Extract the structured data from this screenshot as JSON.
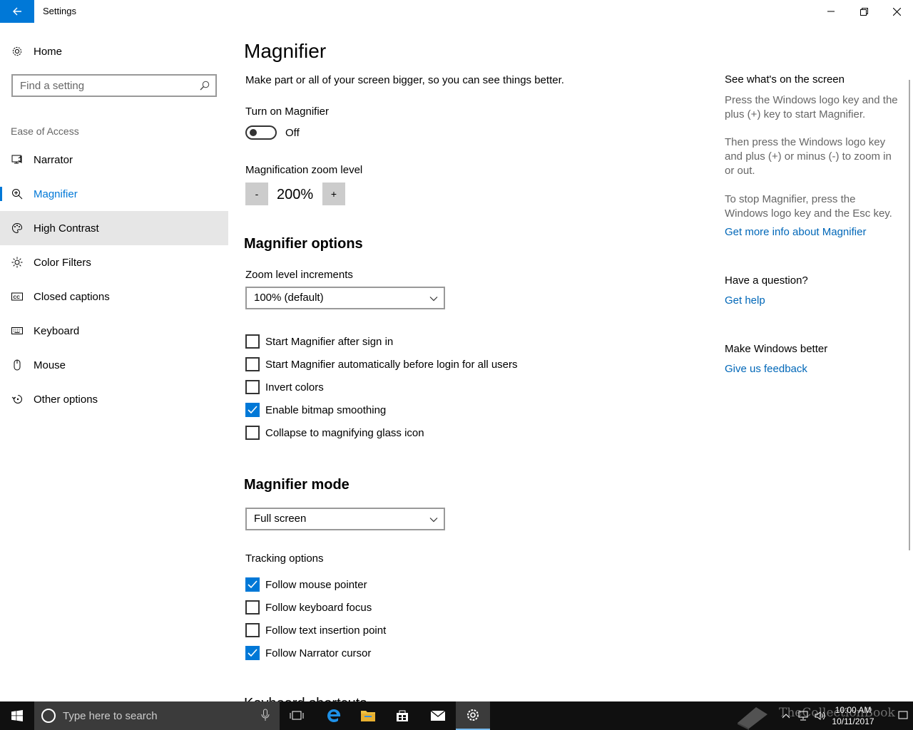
{
  "window": {
    "title": "Settings"
  },
  "sidebar": {
    "home_label": "Home",
    "search_placeholder": "Find a setting",
    "section_label": "Ease of Access",
    "items": [
      {
        "label": "Narrator",
        "icon": "narrator-icon"
      },
      {
        "label": "Magnifier",
        "icon": "magnifier-icon",
        "selected": true
      },
      {
        "label": "High Contrast",
        "icon": "high-contrast-icon",
        "hover": true
      },
      {
        "label": "Color Filters",
        "icon": "color-filters-icon"
      },
      {
        "label": "Closed captions",
        "icon": "closed-captions-icon"
      },
      {
        "label": "Keyboard",
        "icon": "keyboard-icon"
      },
      {
        "label": "Mouse",
        "icon": "mouse-icon"
      },
      {
        "label": "Other options",
        "icon": "other-options-icon"
      }
    ]
  },
  "main": {
    "title": "Magnifier",
    "description": "Make part or all of your screen bigger, so you can see things better.",
    "turn_on_label": "Turn on Magnifier",
    "toggle_state": "Off",
    "zoom_level_label": "Magnification zoom level",
    "zoom_minus": "-",
    "zoom_value": "200%",
    "zoom_plus": "+",
    "options_heading": "Magnifier options",
    "increments_label": "Zoom level increments",
    "increments_value": "100% (default)",
    "checkboxes": [
      {
        "label": "Start Magnifier after sign in",
        "checked": false
      },
      {
        "label": "Start Magnifier automatically before login for all users",
        "checked": false
      },
      {
        "label": "Invert colors",
        "checked": false
      },
      {
        "label": "Enable bitmap smoothing",
        "checked": true
      },
      {
        "label": "Collapse to magnifying glass icon",
        "checked": false
      }
    ],
    "mode_heading": "Magnifier mode",
    "mode_value": "Full screen",
    "tracking_label": "Tracking options",
    "tracking": [
      {
        "label": "Follow mouse pointer",
        "checked": true
      },
      {
        "label": "Follow keyboard focus",
        "checked": false
      },
      {
        "label": "Follow text insertion point",
        "checked": false
      },
      {
        "label": "Follow Narrator cursor",
        "checked": true
      }
    ],
    "partial_heading": "Keyboard shortcuts"
  },
  "right": {
    "see_heading": "See what's on the screen",
    "p1": "Press the Windows logo key and the plus (+) key to start Magnifier.",
    "p2": "Then press the Windows logo key and plus (+) or minus (-) to zoom in or out.",
    "p3": "To stop Magnifier, press the Windows logo key and the Esc key.",
    "more_info_link": "Get more info about Magnifier",
    "question_heading": "Have a question?",
    "help_link": "Get help",
    "better_heading": "Make Windows better",
    "feedback_link": "Give us feedback"
  },
  "taskbar": {
    "search_placeholder": "Type here to search",
    "time": "10:00 AM",
    "date": "10/11/2017",
    "watermark": "TheCollectionBook"
  },
  "colors": {
    "accent": "#0078d7",
    "link": "#0067b8",
    "taskbar": "#101010"
  }
}
